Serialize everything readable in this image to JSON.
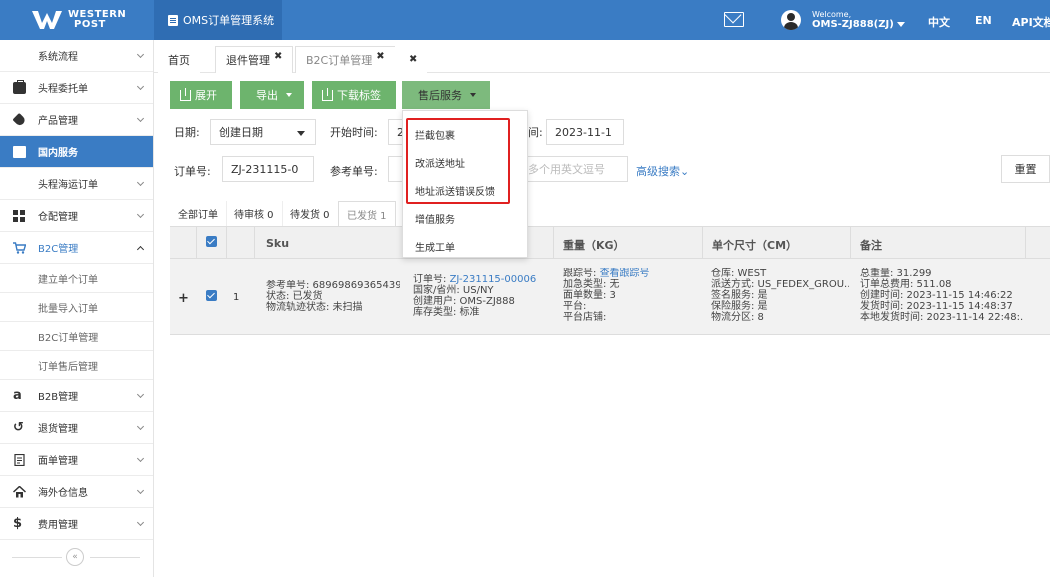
{
  "header": {
    "logo_line1": "WESTERN",
    "logo_line2": "POST",
    "app_title": "OMS订单管理系统",
    "welcome": "Welcome,",
    "user": "OMS-ZJ888(ZJ)",
    "lang_zh": "中文",
    "lang_en": "EN",
    "api_doc": "API文档"
  },
  "sidebar": {
    "items": [
      {
        "label": "系统流程",
        "icon": "none"
      },
      {
        "label": "头程委托单",
        "icon": "briefcase-icon"
      },
      {
        "label": "产品管理",
        "icon": "tag-icon"
      },
      {
        "label": "国内服务",
        "icon": "folder-icon",
        "active": true
      },
      {
        "label": "头程海运订单",
        "icon": "none"
      },
      {
        "label": "仓配管理",
        "icon": "grid-icon"
      },
      {
        "label": "B2C管理",
        "icon": "cart-icon",
        "open": true
      }
    ],
    "sub_items": [
      "建立单个订单",
      "批量导入订单",
      "B2C订单管理",
      "订单售后管理"
    ],
    "items2": [
      {
        "label": "B2B管理",
        "icon": "amazon-icon",
        "glyph": "a"
      },
      {
        "label": "退货管理",
        "icon": "undo-icon",
        "glyph": "↺"
      },
      {
        "label": "面单管理",
        "icon": "document-icon",
        "glyph": ""
      },
      {
        "label": "海外仓信息",
        "icon": "home-icon",
        "glyph": ""
      },
      {
        "label": "费用管理",
        "icon": "dollar-icon",
        "glyph": "$"
      }
    ],
    "collapse": "«"
  },
  "tabs": [
    {
      "label": "首页",
      "closable": false
    },
    {
      "label": "退件管理",
      "closable": true
    },
    {
      "label": "B2C订单管理",
      "closable": true,
      "active": true
    },
    {
      "label": "",
      "closable": true
    }
  ],
  "toolbar": {
    "expand": "展开",
    "export": "导出",
    "download_label": "下载标签",
    "after_sales": "售后服务"
  },
  "filters": {
    "date_label": "日期:",
    "date_type": "创建日期",
    "start_label": "开始时间:",
    "start_value": "2",
    "end_label": "间:",
    "end_value": "2023-11-1",
    "order_no_label": "订单号:",
    "order_no_value": "ZJ-231115-0",
    "ref_no_label": "参考单号:",
    "tracking_placeholder": "多个用英文逗号",
    "advanced_search": "高级搜索",
    "reset": "重置"
  },
  "status_tabs": [
    "全部订单",
    "待审核 0",
    "待发货 0",
    "已发货 1"
  ],
  "table": {
    "headers": {
      "sku": "Sku",
      "weight": "重量（KG）",
      "size": "单个尺寸（CM）",
      "remark": "备注"
    },
    "row": {
      "index": "1",
      "col_sku": [
        "参考单号: 68969869365439...",
        "状态: 已发货",
        "物流轨迹状态: 未扫描"
      ],
      "col_order": {
        "order_label": "订单号:",
        "order_link": "ZJ-231115-00006",
        "lines": [
          "国家/省州: US/NY",
          "创建用户: OMS-ZJ888",
          "库存类型: 标准"
        ]
      },
      "col_weight": {
        "track_label": "跟踪号:",
        "track_link": "查看跟踪号",
        "lines": [
          "加急类型: 无",
          "面单数量: 3",
          "平台:",
          "平台店铺:"
        ]
      },
      "col_size": [
        "仓库: WEST",
        "派送方式: US_FEDEX_GROU...",
        "签名服务: 是",
        "保险服务: 是",
        "物流分区: 8"
      ],
      "col_remark": [
        "总重量: 31.299",
        "订单总费用: 511.08",
        "创建时间: 2023-11-15 14:46:22",
        "发货时间: 2023-11-15 14:48:37",
        "本地发货时间: 2023-11-14 22:48:..."
      ]
    }
  },
  "dropdown": {
    "items": [
      "拦截包裹",
      "改派送地址",
      "地址派送错误反馈",
      "增值服务",
      "生成工单"
    ]
  },
  "colors": {
    "primary": "#3a7cc4",
    "green": "#6db46d",
    "highlight": "#e02020"
  }
}
